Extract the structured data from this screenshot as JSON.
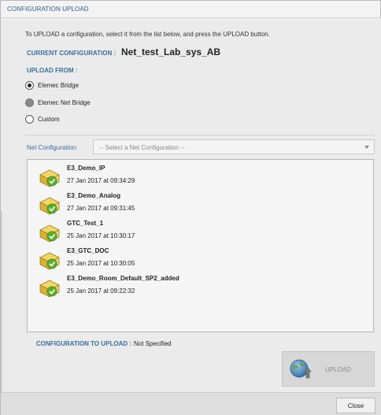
{
  "dialog": {
    "title": "CONFIGURATION UPLOAD",
    "intro": "To UPLOAD a configuration, select it from the list below, and press the UPLOAD button.",
    "current_label": "CURRENT CONFIGURATION :",
    "current_value": "Net_test_Lab_sys_AB",
    "upload_from_label": "UPLOAD FROM :",
    "upload_from_options": [
      {
        "label": "Elemec Bridge",
        "checked": true
      },
      {
        "label": "Elemec Net Bridge",
        "checked": false
      },
      {
        "label": "Custom",
        "checked": false
      }
    ],
    "net_config_label": "Net Configuration:",
    "net_config_placeholder": "-- Select a Net Configuration --",
    "configurations": [
      {
        "name": "E3_Demo_IP",
        "date": "27 Jan 2017 at 09:34:29"
      },
      {
        "name": "E3_Demo_Analog",
        "date": "27 Jan 2017 at 09:31:45"
      },
      {
        "name": "GTC_Test_1",
        "date": "25 Jan 2017 at 10:30:17"
      },
      {
        "name": "E3_GTC_DOC",
        "date": "25 Jan 2017 at 10:30:05"
      },
      {
        "name": "E3_Demo_Room_Default_SP2_added",
        "date": "25 Jan 2017 at 09:22:32"
      }
    ],
    "to_upload_label": "CONFIGURATION TO UPLOAD :",
    "to_upload_value": "Not Specified",
    "upload_button": "UPLOAD",
    "close_button": "Close"
  },
  "colors": {
    "accent": "#3a6d9c",
    "title": "#2b5d8a",
    "config_icon_folder": "#e6c33d",
    "config_icon_check": "#5cae2e"
  },
  "icons": {
    "config_item": "config-file-check-icon",
    "upload": "globe-upload-icon",
    "dropdown": "chevron-down-icon"
  }
}
